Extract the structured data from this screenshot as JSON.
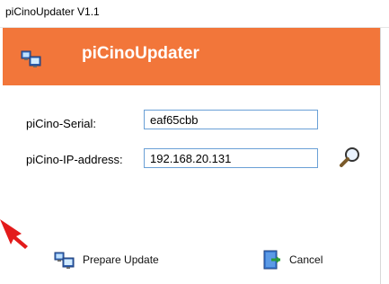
{
  "window": {
    "title": "piCinoUpdater V1.1"
  },
  "banner": {
    "title": "piCinoUpdater",
    "color": "#f2763a",
    "icon": "computers-icon"
  },
  "form": {
    "serial": {
      "label": "piCino-Serial:",
      "value": "eaf65cbb"
    },
    "ip": {
      "label": "piCino-IP-address:",
      "value": "192.168.20.131"
    },
    "search_icon": "magnifier-icon"
  },
  "buttons": {
    "prepare": {
      "label": "Prepare Update",
      "icon": "computers-icon"
    },
    "cancel": {
      "label": "Cancel",
      "icon": "exit-door-icon"
    }
  },
  "annotation": {
    "arrow_color": "#e31b1b"
  }
}
